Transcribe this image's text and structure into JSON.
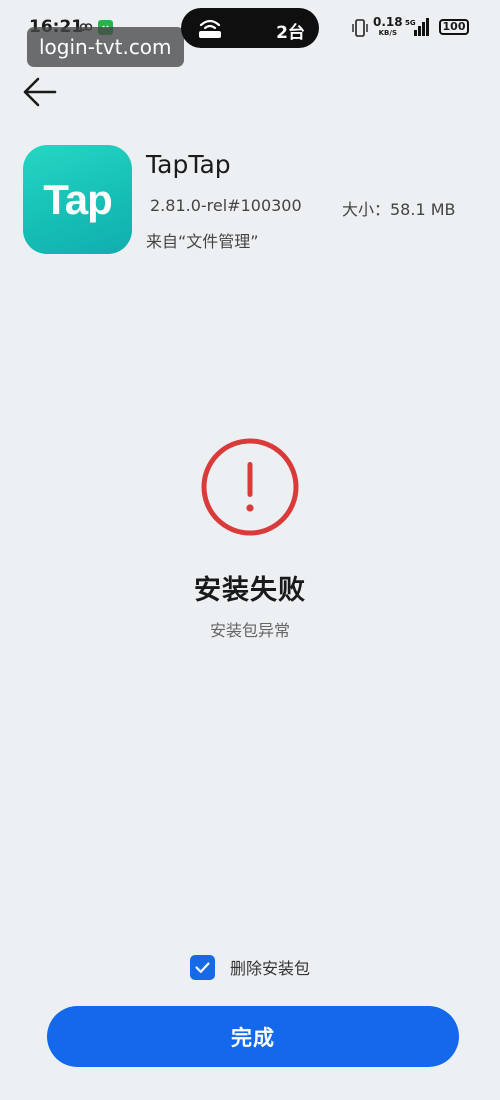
{
  "status_bar": {
    "time": "16:21",
    "island_count": "2台",
    "net_speed_value": "0.18",
    "net_speed_unit": "KB/S",
    "network_type": "5G",
    "battery": "100",
    "icons": [
      "link-icon",
      "wechat-icon",
      "router-icon",
      "vibrate-icon",
      "signal-icon",
      "battery-icon"
    ]
  },
  "watermark": "login-tvt.com",
  "app": {
    "name": "TapTap",
    "icon_text": "Tap",
    "version": "2.81.0-rel#100300",
    "size": "大小：58.1 MB",
    "source": "来自“文件管理”"
  },
  "result": {
    "title": "安装失败",
    "subtitle": "安装包异常"
  },
  "delete_package": {
    "label": "删除安装包",
    "checked": true
  },
  "done_label": "完成",
  "colors": {
    "accent": "#1368ec",
    "error": "#d93a3a",
    "app_icon": "#16c0b5",
    "background": "#edf0f3"
  }
}
